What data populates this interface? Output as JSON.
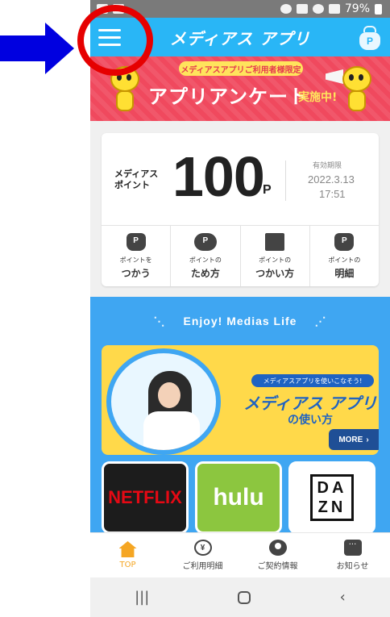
{
  "status_bar": {
    "battery": "79%"
  },
  "header": {
    "title": "メディアス アプリ",
    "wallet_badge": "P"
  },
  "banner": {
    "pill": "メディアスアプリご利用者様限定",
    "title": "アプリアンケート",
    "title_suffix": "実施中!"
  },
  "points": {
    "label": "メディアス\nポイント",
    "value": "100",
    "unit": "P",
    "expiry_label": "有効期限",
    "expiry_date": "2022.3.13",
    "expiry_time": "17:51"
  },
  "point_actions": [
    {
      "small": "ポイントを",
      "main": "つかう"
    },
    {
      "small": "ポイントの",
      "main": "ため方"
    },
    {
      "small": "ポイントの",
      "main": "つかい方"
    },
    {
      "small": "ポイントの",
      "main": "明細"
    }
  ],
  "enjoy": {
    "title": "Enjoy! Medias Life",
    "feature_tag": "メディアスアプリを使いこなそう!",
    "feature_title": "メディアス アプリ",
    "feature_sub": "の使い方",
    "more_label": "MORE",
    "more_chevron": "›"
  },
  "services": [
    "NETFLIX",
    "hulu",
    "DA",
    "ZN"
  ],
  "bottom_nav": [
    {
      "label": "TOP",
      "icon": "home-icon",
      "active": true
    },
    {
      "label": "ご利用明細",
      "icon": "yen-icon",
      "glyph": "¥"
    },
    {
      "label": "ご契約情報",
      "icon": "person-icon"
    },
    {
      "label": "お知らせ",
      "icon": "chat-icon"
    }
  ],
  "system_nav": {
    "recent": "|||",
    "back": "‹"
  },
  "colors": {
    "header_blue": "#29b6f6",
    "banner_red": "#f0495e",
    "section_blue": "#3fa6f2",
    "accent_orange": "#f5a623",
    "annotation_arrow": "#0000e0",
    "annotation_circle": "#e60000"
  }
}
